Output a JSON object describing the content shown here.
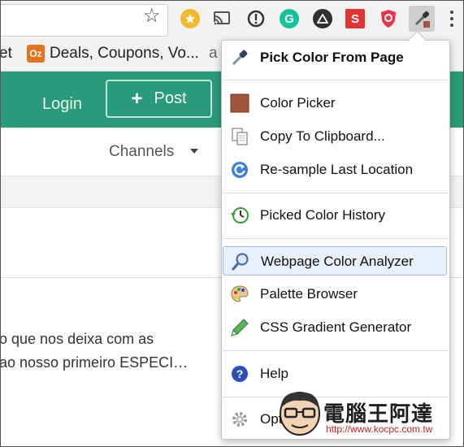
{
  "browser": {
    "bookmarks": {
      "partial_left": "et",
      "deals_icon_text": "Oz",
      "deals": "Deals, Coupons, Vo...",
      "partial_right": "a"
    },
    "extensions": [
      {
        "name": "star-extension-icon"
      },
      {
        "name": "cast-icon"
      },
      {
        "name": "exclamation-icon"
      },
      {
        "name": "grammarly-icon",
        "text": "G"
      },
      {
        "name": "triangle-icon"
      },
      {
        "name": "s-extension-icon",
        "text": "S"
      },
      {
        "name": "shield-icon"
      },
      {
        "name": "eyedropper-extension-icon"
      }
    ]
  },
  "page": {
    "login": "Login",
    "post": "Post",
    "channels": "Channels",
    "snippet_line1": "o que nos deixa com as",
    "snippet_line2": "ao nosso primeiro ESPECI…"
  },
  "menu": {
    "items": [
      {
        "label": "Pick Color From Page",
        "icon": "eyedropper-icon"
      },
      {
        "label": "Color Picker",
        "icon": "color-swatch-icon",
        "swatch": "#a0563a"
      },
      {
        "label": "Copy To Clipboard...",
        "icon": "clipboard-icon"
      },
      {
        "label": "Re-sample Last Location",
        "icon": "refresh-icon"
      },
      {
        "label": "Picked Color History",
        "icon": "history-icon"
      },
      {
        "label": "Webpage Color Analyzer",
        "icon": "magnifier-icon"
      },
      {
        "label": "Palette Browser",
        "icon": "palette-icon"
      },
      {
        "label": "CSS Gradient Generator",
        "icon": "pen-icon"
      },
      {
        "label": "Help",
        "icon": "help-icon"
      },
      {
        "label": "Options",
        "icon": "gear-icon"
      }
    ]
  },
  "watermark": {
    "title": "電腦王阿達",
    "url": "http://www.kocpc.com.tw"
  },
  "colors": {
    "accent_green": "#2a9b78",
    "highlight": "#e9f0fb"
  }
}
